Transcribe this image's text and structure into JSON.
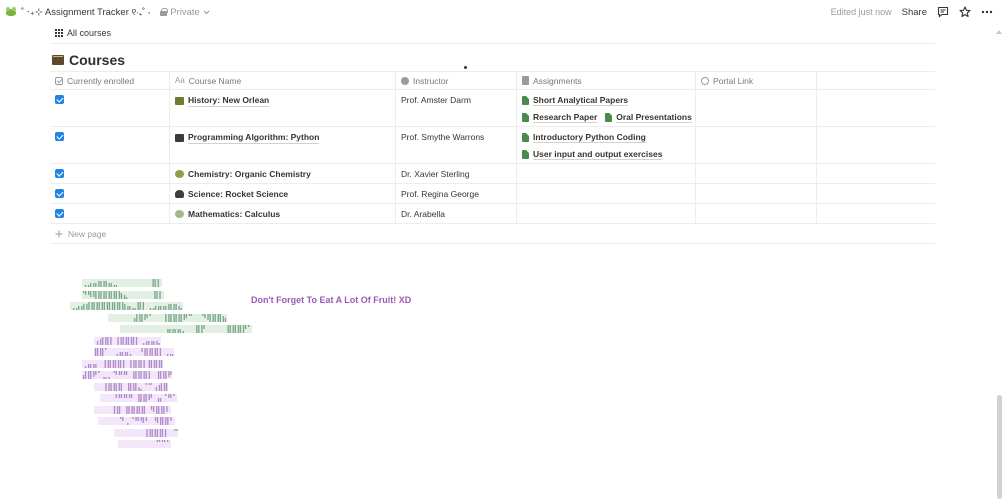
{
  "topbar": {
    "page_title": "˚ ‧₊⊹ Assignment Tracker ୧‧₊˚ ⋅",
    "privacy": "Private",
    "edited": "Edited just now",
    "share": "Share",
    "icons": [
      "frog-icon",
      "lock-icon",
      "comment-icon",
      "star-icon",
      "more-icon"
    ]
  },
  "view": {
    "tab_label": "All courses"
  },
  "database": {
    "title": "Courses",
    "columns": [
      "Currently enrolled",
      "Course Name",
      "Instructor",
      "Assignments",
      "Portal Link"
    ],
    "rows": [
      {
        "enrolled": true,
        "course": "History: New Orlean",
        "instructor": "Prof. Amster Darm",
        "assignments": [
          [
            "Short Analytical Papers"
          ],
          [
            "Research Paper",
            "Oral Presentations"
          ]
        ]
      },
      {
        "enrolled": true,
        "course": "Programming Algorithm: Python",
        "instructor": "Prof. Smythe Warrons",
        "assignments": [
          [
            "Introductory Python Coding"
          ],
          [
            "User input and output exercises"
          ]
        ]
      },
      {
        "enrolled": true,
        "course": "Chemistry: Organic Chemistry",
        "instructor": "Dr. Xavier Sterling",
        "assignments": []
      },
      {
        "enrolled": true,
        "course": "Science: Rocket Science",
        "instructor": "Prof. Regina George",
        "assignments": []
      },
      {
        "enrolled": true,
        "course": "Mathematics: Calculus",
        "instructor": "Dr. Arabella",
        "assignments": []
      }
    ],
    "new_page": "New page"
  },
  "art": {
    "lines": [
      {
        "t": "⢀⣠⣤⣶⣶⣤⣀        ⣿⡇",
        "c": "g"
      },
      {
        "t": "⠙⠻⢿⣿⣿⣿⣿⣷⣄      ⣿⡇",
        "c": "g"
      },
      {
        "t": "⢀⣠⣴⣾⣿⣿⣿⣿⣿⣿⣷⣤⣀⣿⡇⢀⣠⣤⣤⣶⣶⣄",
        "c": "g"
      },
      {
        "t": "      ⣼⣿⠟⠁  ⢸⣿⣿⣿⠟⠉  ⠙⢿⣿⣿⣦",
        "c": "g"
      },
      {
        "t": "           ⣤⣤⣤⡀  ⣿⡟     ⣿⣿⣿⡟⠁",
        "c": "g"
      },
      {
        "t": "⢠⣾⣿⡇⢸⣿⣿⣿⡇⢀⣤⣤⣄",
        "c": "p"
      },
      {
        "t": "⣿⣿⠁ ⢀⣤⣤⡀ ⠘⣿⣿⣿⡇⢀⣀",
        "c": "p"
      },
      {
        "t": "⢀⣤⣤ ⢸⣿⣿⣿⡇⢸⣿⣿⡇⣿⣿⣿",
        "c": "p"
      },
      {
        "t": "⣼⣿⠟⠁⣀⡀⠙⠛⠛ ⣿⣿⣿⡇ ⣿⣿⠟",
        "c": "p"
      },
      {
        "t": "  ⢸⣿⣿⣿ ⣿⣿⣄⠈⠉⢠⣾⣿",
        "c": "p"
      },
      {
        "t": "   ⠘⠛⠛⠛ ⣿⣿⠟ ⣤⠈⠛⠁",
        "c": "p"
      },
      {
        "t": "    ⢸⣿ ⣿⣿⣿⣿ ⠻⣿⣿⠇",
        "c": "p"
      },
      {
        "t": "     ⠙⢀⠈⠛⠻⠃ ⠻⣿⣿⠃",
        "c": "p"
      },
      {
        "t": "       ⢸⣿⣿⣿⡇ ⠉",
        "c": "p"
      },
      {
        "t": "         ⠉⠉⠁",
        "c": "p"
      }
    ],
    "note": "Don't Forget To Eat A Lot Of Fruit! XD"
  }
}
